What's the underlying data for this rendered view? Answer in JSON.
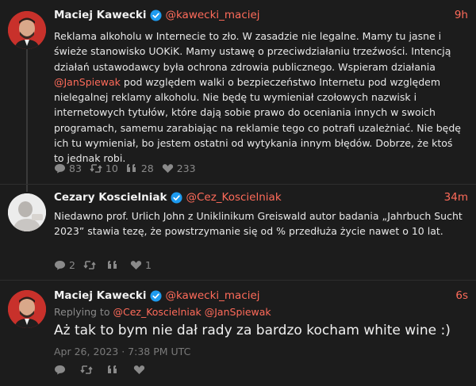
{
  "tweets": [
    {
      "author": "Maciej Kawecki",
      "handle": "@kawecki_maciej",
      "time": "9h",
      "text_a": "Reklama alkoholu w Internecie to zło. W zasadzie nie legalne. Mamy tu jasne i świeże stanowisko UOKiK. Mamy ustawę o przeciwdziałaniu trzeźwości. Intencją działań ustawodawcy była ochrona zdrowia publicznego. Wspieram działania ",
      "mention": "@JanSpiewak",
      "text_b": " pod względem walki o bezpieczeństwo Internetu pod względem nielegalnej reklamy alkoholu. Nie będę tu wymieniał czołowych nazwisk i internetowych tytułów, które dają sobie prawo do oceniania innych w swoich programach, samemu zarabiając na reklamie tego co potrafi uzależniać. Nie będę ich tu wymieniał, bo jestem ostatni od wytykania innym błędów. Dobrze, że ktoś to jednak robi.",
      "replies": "83",
      "retweets": "10",
      "quotes": "28",
      "likes": "233"
    },
    {
      "author": "Cezary Koscielniak",
      "handle": "@Cez_Koscielniak",
      "time": "34m",
      "text": "Niedawno prof. Urlich John z Uniklinikum Greiswald autor badania „Jahrbuch Sucht 2023” stawia tezę, że powstrzymanie się od % przedłuża życie nawet o 10 lat.",
      "replies": "2",
      "retweets": "",
      "likes": "1"
    },
    {
      "author": "Maciej Kawecki",
      "handle": "@kawecki_maciej",
      "time": "6s",
      "replying_label": "Replying to",
      "replying_to": [
        "@Cez_Koscielniak",
        "@JanSpiewak"
      ],
      "text": "Aż tak to bym nie dał rady za bardzo kocham white wine :)",
      "date": "Apr 26, 2023 · 7:38 PM UTC"
    }
  ],
  "colors": {
    "accent": "#ff6b5a",
    "background": "#1c1c1c",
    "verified": "#1d9bf0"
  },
  "icons": [
    "verified-badge-icon",
    "reply-icon",
    "retweet-icon",
    "quote-icon",
    "like-icon"
  ]
}
